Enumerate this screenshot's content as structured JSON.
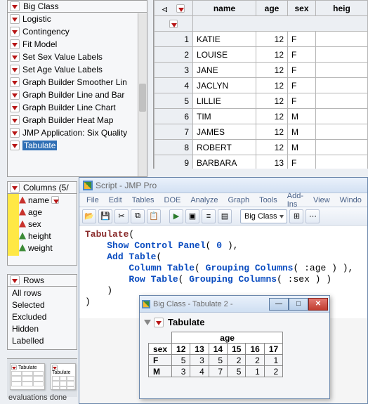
{
  "script_panel": {
    "title": "Big Class",
    "items": [
      "Logistic",
      "Contingency",
      "Fit Model",
      "Set Sex Value Labels",
      "Set Age Value Labels",
      "Graph Builder Smoother Lin",
      "Graph Builder Line and Bar",
      "Graph Builder Line Chart",
      "Graph Builder Heat Map",
      "JMP Application: Six Quality",
      "Tabulate"
    ],
    "selected_index": 10
  },
  "columns_panel": {
    "title": "Columns (5/",
    "cols": [
      {
        "name": "name",
        "type": "red",
        "disc": true
      },
      {
        "name": "age",
        "type": "red"
      },
      {
        "name": "sex",
        "type": "red"
      },
      {
        "name": "height",
        "type": "green"
      },
      {
        "name": "weight",
        "type": "green"
      }
    ]
  },
  "rows_panel": {
    "title": "Rows",
    "rows": [
      "All rows",
      "Selected",
      "Excluded",
      "Hidden",
      "Labelled"
    ]
  },
  "thumbs": {
    "label": "Tabulate"
  },
  "status": "evaluations done",
  "data_table": {
    "headers": [
      "",
      "name",
      "age",
      "sex",
      "heig"
    ],
    "rows": [
      {
        "n": 1,
        "name": "KATIE",
        "age": 12,
        "sex": "F"
      },
      {
        "n": 2,
        "name": "LOUISE",
        "age": 12,
        "sex": "F"
      },
      {
        "n": 3,
        "name": "JANE",
        "age": 12,
        "sex": "F"
      },
      {
        "n": 4,
        "name": "JACLYN",
        "age": 12,
        "sex": "F"
      },
      {
        "n": 5,
        "name": "LILLIE",
        "age": 12,
        "sex": "F"
      },
      {
        "n": 6,
        "name": "TIM",
        "age": 12,
        "sex": "M"
      },
      {
        "n": 7,
        "name": "JAMES",
        "age": 12,
        "sex": "M"
      },
      {
        "n": 8,
        "name": "ROBERT",
        "age": 12,
        "sex": "M"
      },
      {
        "n": 9,
        "name": "BARBARA",
        "age": 13,
        "sex": "F"
      }
    ]
  },
  "editor": {
    "title": "Script - JMP Pro",
    "menu": [
      "File",
      "Edit",
      "Tables",
      "DOE",
      "Analyze",
      "Graph",
      "Tools",
      "Add-Ins",
      "View",
      "Windo"
    ],
    "combo": "Big Class",
    "code": {
      "l1a": "Tabulate",
      "l1b": "(",
      "l2a": "Show Control Panel",
      "l2b": "( ",
      "l2c": "0",
      "l2d": " ),",
      "l3a": "Add Table",
      "l3b": "(",
      "l4a": "Column Table",
      "l4b": "( ",
      "l4c": "Grouping Columns",
      "l4d": "( :age ) ),",
      "l5a": "Row Table",
      "l5b": "( ",
      "l5c": "Grouping Columns",
      "l5d": "( :sex ) )",
      "l6": ")",
      "l7": ")"
    }
  },
  "tabwin": {
    "title": "Big Class - Tabulate 2 -",
    "heading": "Tabulate",
    "age_label": "age",
    "sex_label": "sex"
  },
  "chart_data": {
    "type": "table",
    "title": "Tabulate",
    "row_dim": "sex",
    "col_dim": "age",
    "columns": [
      12,
      13,
      14,
      15,
      16,
      17
    ],
    "rows": [
      {
        "sex": "F",
        "values": [
          5,
          3,
          5,
          2,
          2,
          1
        ]
      },
      {
        "sex": "M",
        "values": [
          3,
          4,
          7,
          5,
          1,
          2
        ]
      }
    ]
  }
}
